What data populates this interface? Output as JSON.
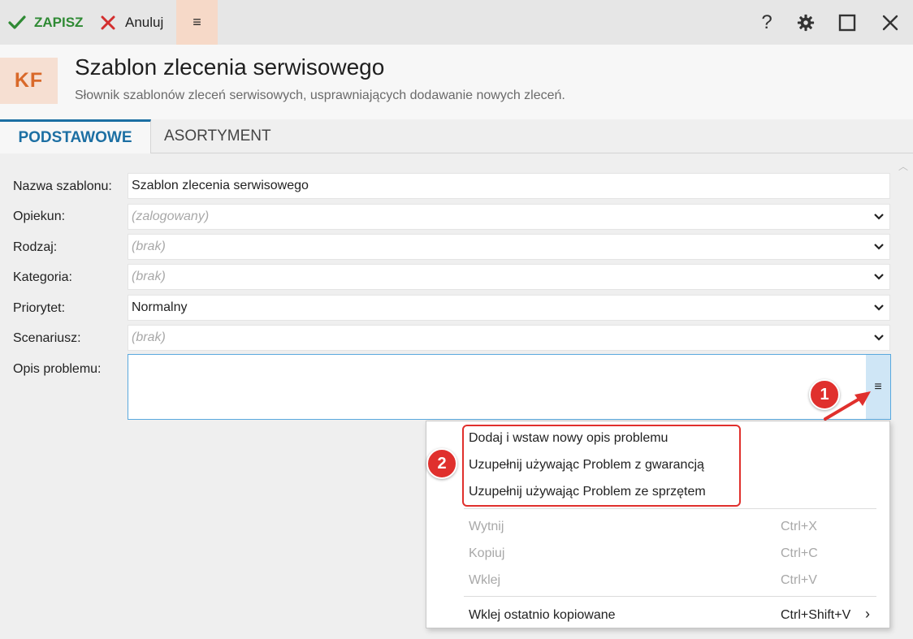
{
  "toolbar": {
    "save_label": "ZAPISZ",
    "cancel_label": "Anuluj",
    "menu_glyph": "≡",
    "help_glyph": "?"
  },
  "header": {
    "logo_text": "KF",
    "title": "Szablon zlecenia serwisowego",
    "subtitle": "Słownik szablonów zleceń serwisowych, usprawniających dodawanie nowych zleceń."
  },
  "tabs": [
    {
      "label": "PODSTAWOWE",
      "active": true
    },
    {
      "label": "ASORTYMENT",
      "active": false
    }
  ],
  "form": {
    "nazwa": {
      "label": "Nazwa szablonu:",
      "value": "Szablon zlecenia serwisowego"
    },
    "opiekun": {
      "label": "Opiekun:",
      "placeholder": "(zalogowany)"
    },
    "rodzaj": {
      "label": "Rodzaj:",
      "placeholder": "(brak)"
    },
    "kategoria": {
      "label": "Kategoria:",
      "placeholder": "(brak)"
    },
    "priorytet": {
      "label": "Priorytet:",
      "value": "Normalny"
    },
    "scenariusz": {
      "label": "Scenariusz:",
      "placeholder": "(brak)"
    },
    "opis": {
      "label": "Opis problemu:",
      "value": "",
      "button_glyph": "≡"
    }
  },
  "annotations": {
    "badge1": "1",
    "badge2": "2",
    "color": "#e0302d"
  },
  "context_menu": {
    "custom_items": [
      "Dodaj i wstaw nowy opis problemu",
      "Uzupełnij używając Problem z gwarancją",
      "Uzupełnij używając Problem ze sprzętem"
    ],
    "edit_items": [
      {
        "label": "Wytnij",
        "shortcut": "Ctrl+X",
        "disabled": true
      },
      {
        "label": "Kopiuj",
        "shortcut": "Ctrl+C",
        "disabled": true
      },
      {
        "label": "Wklej",
        "shortcut": "Ctrl+V",
        "disabled": true
      }
    ],
    "paste_recent": {
      "label": "Wklej ostatnio kopiowane",
      "shortcut": "Ctrl+Shift+V",
      "submenu_glyph": "›"
    }
  },
  "colors": {
    "accent_blue": "#1c6fa3",
    "save_green": "#2f8a34",
    "cancel_red": "#d32f2f",
    "logo_orange": "#d9692a"
  }
}
